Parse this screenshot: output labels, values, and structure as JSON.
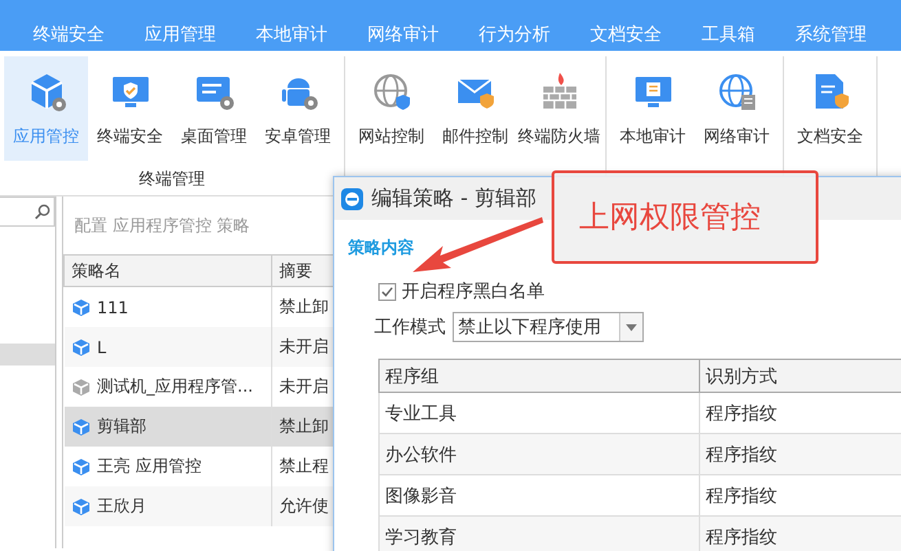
{
  "menu_tabs": [
    "终端安全",
    "应用管理",
    "本地审计",
    "网络审计",
    "行为分析",
    "文档安全",
    "工具箱",
    "系统管理"
  ],
  "ribbon": {
    "groups": [
      {
        "label": "终端管理",
        "items": [
          {
            "label": "应用管控",
            "selected": true
          },
          {
            "label": "终端安全",
            "selected": false
          },
          {
            "label": "桌面管理",
            "selected": false
          },
          {
            "label": "安卓管理",
            "selected": false
          }
        ]
      },
      {
        "items": [
          {
            "label": "网站控制",
            "selected": false
          },
          {
            "label": "邮件控制",
            "selected": false
          },
          {
            "label": "终端防火墙",
            "selected": false
          }
        ]
      },
      {
        "items": [
          {
            "label": "本地审计",
            "selected": false
          },
          {
            "label": "网络审计",
            "selected": false
          }
        ]
      },
      {
        "items": [
          {
            "label": "文档安全",
            "selected": false
          }
        ]
      }
    ]
  },
  "policy_panel": {
    "heading": "配置 应用程序管控 策略",
    "columns": [
      "策略名",
      "摘要"
    ],
    "rows": [
      {
        "name": "111",
        "summary": "禁止卸",
        "enabled": true,
        "selected": false
      },
      {
        "name": "L",
        "summary": "未开启",
        "enabled": true,
        "selected": false
      },
      {
        "name": "测试机_应用程序管...",
        "summary": "未开启",
        "enabled": false,
        "selected": false
      },
      {
        "name": "剪辑部",
        "summary": "禁止卸",
        "enabled": true,
        "selected": true
      },
      {
        "name": "王亮 应用管控",
        "summary": "禁止程",
        "enabled": true,
        "selected": false
      },
      {
        "name": "王欣月",
        "summary": "允许使",
        "enabled": true,
        "selected": false
      }
    ]
  },
  "dialog": {
    "title": "编辑策略 - 剪辑部",
    "section": "策略内容",
    "checkbox": {
      "label": "开启程序黑白名单",
      "checked": true
    },
    "mode": {
      "label": "工作模式",
      "value": "禁止以下程序使用"
    },
    "columns": [
      "程序组",
      "识别方式"
    ],
    "rows": [
      [
        "专业工具",
        "程序指纹"
      ],
      [
        "办公软件",
        "程序指纹"
      ],
      [
        "图像影音",
        "程序指纹"
      ],
      [
        "学习教育",
        "程序指纹"
      ]
    ]
  },
  "callout": {
    "text": "上网权限管控"
  }
}
